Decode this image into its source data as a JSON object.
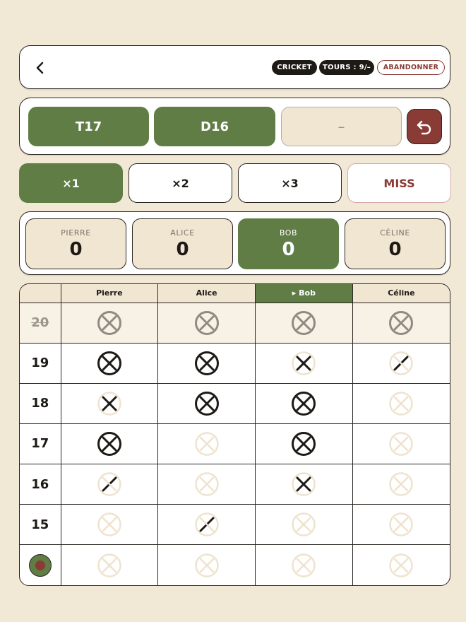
{
  "header": {
    "back_icon": "chevron-left-icon",
    "mode_label": "CRICKET",
    "turns_label": "TOURS : 9/–",
    "abandon_label": "ABANDONNER"
  },
  "darts": {
    "slots": [
      "T17",
      "D16",
      "–"
    ],
    "undo_icon": "undo-icon"
  },
  "multipliers": {
    "items": [
      "×1",
      "×2",
      "×3",
      "MISS"
    ],
    "active": "×1"
  },
  "scores": [
    {
      "name": "PIERRE",
      "value": "0"
    },
    {
      "name": "ALICE",
      "value": "0"
    },
    {
      "name": "BOB",
      "value": "0"
    },
    {
      "name": "CÉLINE",
      "value": "0"
    }
  ],
  "active_player": "Bob",
  "grid": {
    "columns": [
      "Pierre",
      "Alice",
      "▸ Bob",
      "Céline"
    ],
    "rows": [
      {
        "label": "20",
        "closed": true,
        "marks": [
          3,
          3,
          3,
          3
        ]
      },
      {
        "label": "19",
        "closed": false,
        "marks": [
          3,
          3,
          2,
          1
        ]
      },
      {
        "label": "18",
        "closed": false,
        "marks": [
          2,
          3,
          3,
          0
        ]
      },
      {
        "label": "17",
        "closed": false,
        "marks": [
          3,
          0,
          3,
          0
        ]
      },
      {
        "label": "16",
        "closed": false,
        "marks": [
          1,
          0,
          2,
          0
        ]
      },
      {
        "label": "15",
        "closed": false,
        "marks": [
          0,
          1,
          0,
          0
        ]
      },
      {
        "label": "",
        "bull": true,
        "closed": false,
        "marks": [
          0,
          0,
          0,
          0
        ]
      }
    ]
  },
  "colors": {
    "accent_green": "#5f7d44",
    "accent_red": "#8a3b35",
    "ink": "#1d1a16",
    "cream": "#f2e8d6",
    "faint": "#efe3cf",
    "closed_grey": "#8f8a82"
  }
}
